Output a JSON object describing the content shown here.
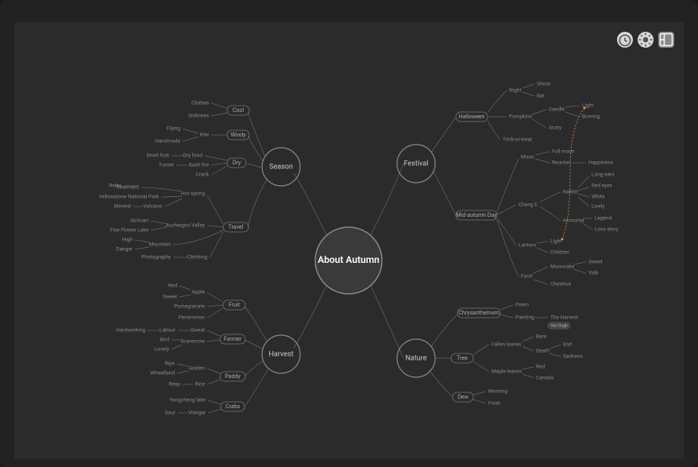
{
  "center": "About Autumn",
  "branches": {
    "season": {
      "label": "Season",
      "children": {
        "cool": {
          "label": "Cool",
          "leaves": [
            "Clothes",
            "Sickness"
          ]
        },
        "windy": {
          "label": "Windy",
          "kite": "Kite",
          "leaves": [
            "Flying",
            "Handmade"
          ]
        },
        "dry": {
          "label": "Dry",
          "dryfood": "Dry food",
          "bushfire": "Bush fire",
          "leaves": [
            "Dried fruit",
            "Forest",
            "Crack"
          ]
        },
        "travel": {
          "label": "Travel",
          "hotspring": {
            "label": "Hot spring",
            "leaves": [
              "Relax",
              "Treatment",
              "Yellowstone National Park",
              "Mineral",
              "Volcano"
            ]
          },
          "jiuzhaigou": {
            "label": "Jiuzhaigou Valley",
            "leaves": [
              "Sichuan",
              "Five Flower Lake"
            ]
          },
          "mountain": {
            "label": "Mountain",
            "leaves": [
              "High",
              "Danger"
            ]
          },
          "climbing": {
            "label": "Climbing",
            "leaves": [
              "Photography"
            ]
          }
        }
      }
    },
    "festival": {
      "label": "Festival",
      "children": {
        "halloween": {
          "label": "Halloween",
          "night": {
            "label": "Night",
            "leaves": [
              "Ghost",
              "Bat"
            ]
          },
          "pumpkins": {
            "label": "Pumpkins",
            "candle": "Candle",
            "leaves": [
              "Light",
              "Burning",
              "Scary"
            ]
          },
          "trick": "Trick-or-treat"
        },
        "midautumn": {
          "label": "Mid-autumn Day",
          "moon": {
            "label": "Moon",
            "leaves": [
              "Full moon",
              "Reunion",
              "Happiness"
            ]
          },
          "change": {
            "label": "Chang E",
            "rabbit": {
              "label": "Rabbit",
              "leaves": [
                "Long ears",
                "Red eyes",
                "White",
                "Lively"
              ]
            },
            "immortal": {
              "label": "Immortal",
              "leaves": [
                "Legend",
                "Love story"
              ]
            }
          },
          "lantern": {
            "label": "Lantern",
            "leaves": [
              "Light",
              "Children"
            ]
          },
          "food": {
            "label": "Food",
            "mooncake": "Mooncake",
            "chestnut": "Chestnut",
            "leaves": [
              "Sweet",
              "Yolk"
            ]
          }
        }
      }
    },
    "harvest": {
      "label": "Harvest",
      "children": {
        "fruit": {
          "label": "Fruit",
          "apple": "Apple",
          "pomegranate": "Pomegranate",
          "persimmon": "Persimmon",
          "leaves": [
            "Red",
            "Sweet"
          ]
        },
        "farmer": {
          "label": "Farmer",
          "sweat": "Sweat",
          "scarecrow": "Scarecrow",
          "labour": "Labour",
          "bird": "Bird",
          "lonely": "Lonely",
          "hardworking": "Hardworking"
        },
        "paddy": {
          "label": "Paddy",
          "golden": "Golden",
          "rice": "Rice",
          "ripe": "Ripe",
          "wheatland": "Wheatland",
          "reap": "Reap"
        },
        "crabs": {
          "label": "Crabs",
          "yangcheng": "Yangcheng lake",
          "vinegar": "Vinegar",
          "sour": "Sour"
        }
      }
    },
    "nature": {
      "label": "Nature",
      "children": {
        "chrysanthemum": {
          "label": "Chrysanthemum",
          "poem": "Poem",
          "painting": "Painting",
          "harvest": "The Harvest",
          "vangogh": "Van Gogh"
        },
        "tree": {
          "label": "Tree",
          "fallen": {
            "label": "Fallen leaves",
            "leaves": [
              "Bare",
              "Death",
              "End",
              "Sadness"
            ]
          },
          "maple": {
            "label": "Maple leaves",
            "leaves": [
              "Red",
              "Canada"
            ]
          }
        },
        "dew": {
          "label": "Dew",
          "leaves": [
            "Morning",
            "Frost"
          ]
        }
      }
    }
  }
}
